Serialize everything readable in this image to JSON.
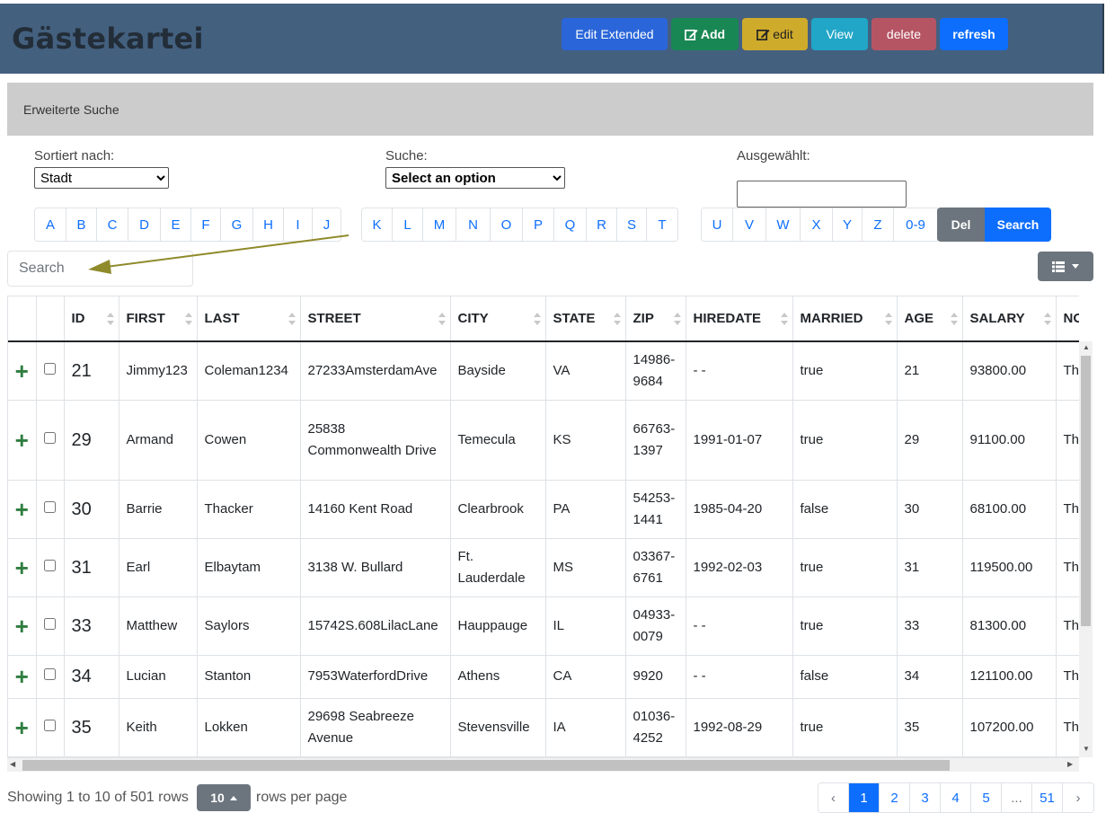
{
  "app": {
    "title": "Gästekartei"
  },
  "toolbar": {
    "buttons": [
      {
        "id": "edit-extended",
        "label": "Edit Extended",
        "color": "#2a66d9",
        "icon": ""
      },
      {
        "id": "add",
        "label": "Add",
        "color": "#198754",
        "icon": "edit-icon"
      },
      {
        "id": "edit",
        "label": "edit",
        "color": "#cfab2c",
        "icon": "edit-icon"
      },
      {
        "id": "view",
        "label": "View",
        "color": "#21a6c7",
        "icon": ""
      },
      {
        "id": "delete",
        "label": "delete",
        "color": "#b55564",
        "icon": ""
      },
      {
        "id": "refresh",
        "label": "refresh",
        "color": "#0d6efd",
        "icon": ""
      }
    ]
  },
  "panel": {
    "heading": "Erweiterte Suche"
  },
  "filters": {
    "sort_label": "Sortiert nach:",
    "sort_value": "Stadt",
    "search_label": "Suche:",
    "search_value": "Select an option",
    "selected_label": "Ausgewählt:"
  },
  "letters": {
    "group1": [
      "A",
      "B",
      "C",
      "D",
      "E",
      "F",
      "G",
      "H",
      "I",
      "J"
    ],
    "group2": [
      "K",
      "L",
      "M",
      "N",
      "O",
      "P",
      "Q",
      "R",
      "S",
      "T"
    ],
    "group3": [
      "U",
      "V",
      "W",
      "X",
      "Y",
      "Z",
      "0-9"
    ],
    "del_label": "Del",
    "search_label": "Search"
  },
  "search": {
    "placeholder": "Search"
  },
  "table": {
    "headers": [
      "ID",
      "FIRST",
      "LAST",
      "STREET",
      "CITY",
      "STATE",
      "ZIP",
      "HIREDATE",
      "MARRIED",
      "AGE",
      "SALARY",
      "NOTES"
    ],
    "rows": [
      [
        "21",
        "Jimmy123",
        "Coleman1234",
        "27233AmsterdamAve",
        "Bayside",
        "VA",
        "14986-9684",
        "- -",
        "true",
        "21",
        "93800.00",
        "Th"
      ],
      [
        "29",
        "Armand",
        "Cowen",
        "25838 Commonwealth Drive",
        "Temecula",
        "KS",
        "66763-1397",
        "1991-01-07",
        "true",
        "29",
        "91100.00",
        "Th rec"
      ],
      [
        "30",
        "Barrie",
        "Thacker",
        "14160 Kent Road",
        "Clearbrook",
        "PA",
        "54253-1441",
        "1985-04-20",
        "false",
        "30",
        "68100.00",
        "Th rec"
      ],
      [
        "31",
        "Earl",
        "Elbaytam",
        "3138 W. Bullard",
        "Ft. Lauderdale",
        "MS",
        "03367-6761",
        "1992-02-03",
        "true",
        "31",
        "119500.00",
        "Th rec"
      ],
      [
        "33",
        "Matthew",
        "Saylors",
        "15742S.608LilacLane",
        "Hauppauge",
        "IL",
        "04933-0079",
        "- -",
        "true",
        "33",
        "81300.00",
        "Th"
      ],
      [
        "34",
        "Lucian",
        "Stanton",
        "7953WaterfordDrive",
        "Athens",
        "CA",
        "9920",
        "- -",
        "false",
        "34",
        "121100.00",
        "Th"
      ],
      [
        "35",
        "Keith",
        "Lokken",
        "29698 Seabreeze Avenue",
        "Stevensville",
        "IA",
        "01036-4252",
        "1992-08-29",
        "true",
        "35",
        "107200.00",
        "Th rec"
      ]
    ]
  },
  "footer": {
    "info": "Showing 1 to 10 of 501 rows",
    "page_size": "10",
    "rows_per_page": "rows per page",
    "pages": [
      "‹",
      "1",
      "2",
      "3",
      "4",
      "5",
      "...",
      "51",
      "›"
    ],
    "active_page": "1"
  },
  "colors": {
    "header_bg": "#44607f",
    "title": "#222d38",
    "accent": "#0d6efd",
    "plus": "#2f7d3f",
    "arrow": "#8f8a2a"
  }
}
